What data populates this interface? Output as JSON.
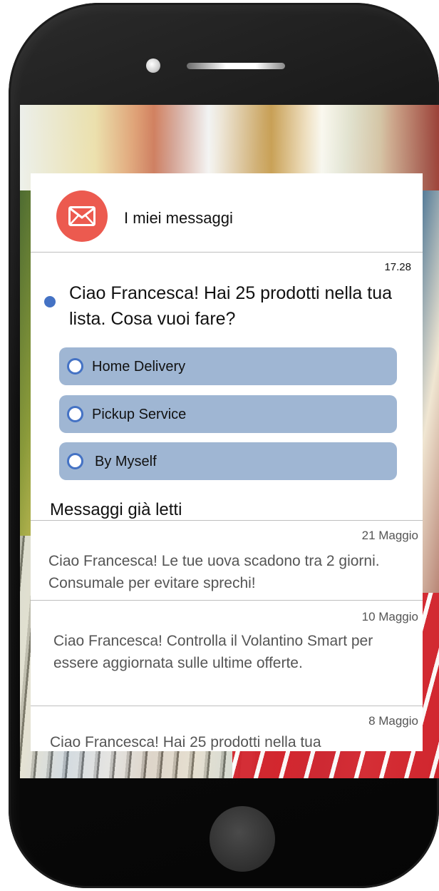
{
  "header": {
    "title": "I miei messaggi"
  },
  "unread": {
    "time": "17.28",
    "text": "Ciao Francesca! Hai 25 prodotti nella tua lista. Cosa vuoi fare?",
    "options": [
      {
        "label": "Home Delivery"
      },
      {
        "label": "Pickup Service"
      },
      {
        "label": "By Myself"
      }
    ]
  },
  "read_section": {
    "title": "Messaggi già letti",
    "messages": [
      {
        "date": "21 Maggio",
        "text": "Ciao Francesca! Le tue uova scadono tra 2 giorni. Consumale per evitare sprechi!"
      },
      {
        "date": "10 Maggio",
        "text": "Ciao Francesca! Controlla il Volantino Smart per essere aggiornata sulle ultime offerte."
      },
      {
        "date": "8 Maggio",
        "text": "Ciao Francesca! Hai 25 prodotti nella tua"
      }
    ]
  },
  "colors": {
    "accent_blue": "#4472c4",
    "option_bg": "#9fb6d3",
    "mail_icon_bg": "#ec5a4f"
  },
  "icons": [
    "mail-icon",
    "radio-icon"
  ]
}
